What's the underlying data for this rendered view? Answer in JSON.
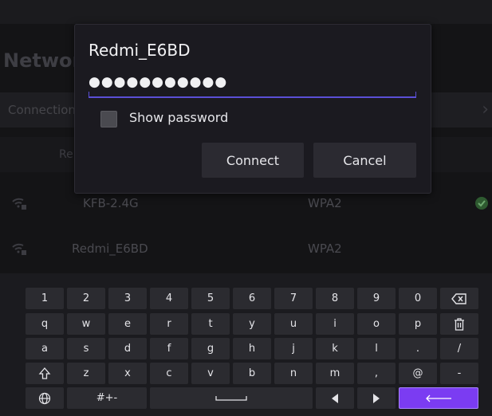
{
  "background": {
    "title": "Network",
    "connection_label": "Connection",
    "list_header_label": "Re",
    "networks": [
      {
        "name": "KFB-2.4G",
        "security": "WPA2",
        "connected": true
      },
      {
        "name": "Redmi_E6BD",
        "security": "WPA2",
        "connected": false
      }
    ]
  },
  "dialog": {
    "title": "Redmi_E6BD",
    "password_masked": "●●●●●●●●●●●",
    "show_password_label": "Show password",
    "show_password_checked": false,
    "connect_label": "Connect",
    "cancel_label": "Cancel"
  },
  "keyboard": {
    "rows": [
      [
        "1",
        "2",
        "3",
        "4",
        "5",
        "6",
        "7",
        "8",
        "9",
        "0",
        "backspace"
      ],
      [
        "q",
        "w",
        "e",
        "r",
        "t",
        "y",
        "u",
        "i",
        "o",
        "p",
        "clear"
      ],
      [
        "a",
        "s",
        "d",
        "f",
        "g",
        "h",
        "j",
        "k",
        "l",
        ".",
        "/"
      ],
      [
        "shift",
        "z",
        "x",
        "c",
        "v",
        "b",
        "n",
        "m",
        ",",
        "@",
        "-"
      ]
    ],
    "symbols_label": "#+-"
  },
  "colors": {
    "accent": "#7b3cf2",
    "field_underline": "#5b4fd6",
    "connected": "#2e5a30"
  }
}
